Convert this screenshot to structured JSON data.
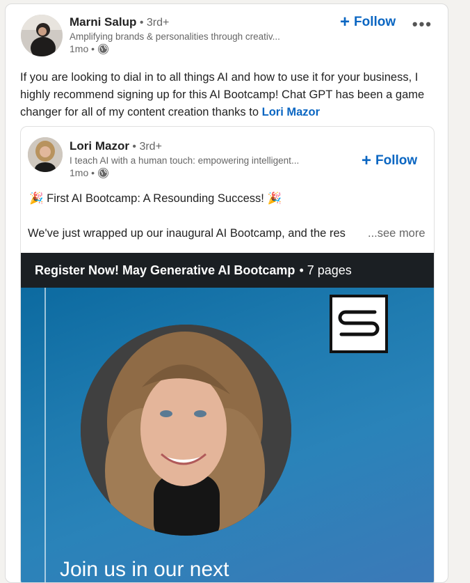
{
  "post": {
    "author": {
      "name": "Marni Salup",
      "degree": "• 3rd+",
      "headline": "Amplifying brands & personalities through creativ...",
      "time": "1mo •"
    },
    "follow_label": "Follow",
    "more_label": "•••",
    "text_main": "If you are looking to dial in to all things AI and how to use it for your business, I highly recommend signing up for this AI Bootcamp! Chat GPT has been a game changer for all of my content creation thanks to ",
    "mention": "Lori Mazor"
  },
  "shared": {
    "author": {
      "name": "Lori Mazor",
      "degree": "• 3rd+",
      "headline": "I teach AI with a human touch: empowering intelligent...",
      "time": "1mo •"
    },
    "follow_label": "Follow",
    "title_line": "🎉 First AI Bootcamp: A Resounding Success! 🎉",
    "body_line": "We've just wrapped up our inaugural AI Bootcamp, and the res",
    "see_more": "...see more",
    "document": {
      "title": "Register Now! May Generative AI Bootcamp",
      "pages": "• 7 pages",
      "overlay_text": "Join us in our next"
    }
  },
  "icons": {
    "globe": "globe-icon",
    "plus": "plus-icon",
    "more": "more-icon",
    "logo": "s-logo"
  },
  "colors": {
    "link": "#0a66c2",
    "doc_bar": "#1b1f23"
  }
}
